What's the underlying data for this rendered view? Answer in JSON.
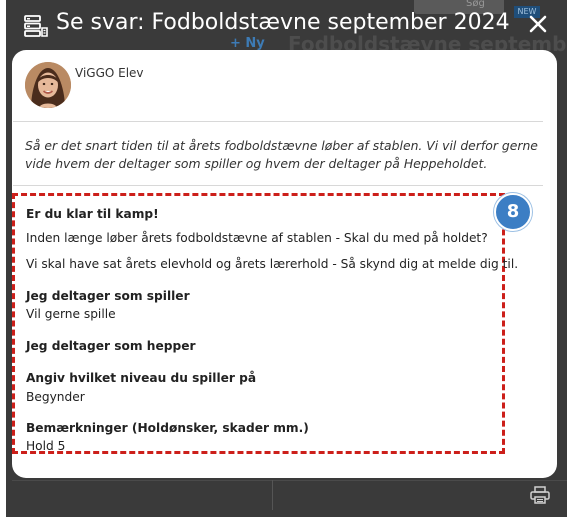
{
  "background": {
    "search_hint": "Søg",
    "nav_badge": "NEW",
    "page_title": "Fodboldstævne september",
    "add_label": "+ Ny"
  },
  "modal": {
    "title": "Se svar: Fodboldstævne september 2024",
    "close_icon": "close-icon",
    "form_icon": "form-icon"
  },
  "sender": {
    "name": "ViGGO Elev"
  },
  "message": "Så er det snart tiden til at årets fodboldstævne løber af stablen. Vi vil derfor gerne vide hvem der deltager som spiller og hvem der deltager på Heppeholdet.",
  "answers": {
    "heading": "Er du klar til kamp!",
    "intro1": "Inden længe løber årets fodboldstævne af stablen - Skal du med på holdet?",
    "intro2": "Vi skal have sat årets elevhold og årets lærerhold - Så skynd dig at melde dig til.",
    "q1": "Jeg deltager som spiller",
    "a1": "Vil gerne spille",
    "q2": "Jeg deltager som hepper",
    "q3": "Angiv hvilket niveau du spiller på",
    "a3": "Begynder",
    "q4": "Bemærkninger (Holdønsker, skader mm.)",
    "a4": "Hold 5"
  },
  "badge": "8",
  "colors": {
    "accent": "#3c7ec4",
    "highlight_border": "#cc1f1a",
    "overlay": "#3a3a3a"
  }
}
